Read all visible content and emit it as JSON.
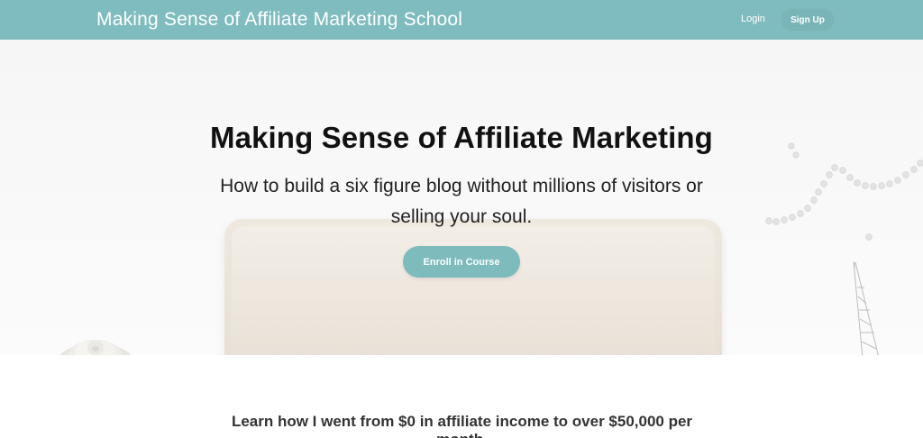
{
  "header": {
    "brand": "Making Sense of Affiliate Marketing School",
    "login_label": "Login",
    "signup_label": "Sign Up"
  },
  "hero": {
    "title": "Making Sense of Affiliate Marketing",
    "subtitle": "How to build a six figure blog without millions of visitors or selling your soul.",
    "cta_label": "Enroll in Course"
  },
  "content": {
    "intro": "Learn how I went from $0 in affiliate income to over $50,000 per month."
  },
  "colors": {
    "accent": "#7fbcbf",
    "cta": "#7dbbbd",
    "text_dark": "#111111"
  },
  "icons": {
    "decor_left": "flower-decoration",
    "decor_right_pearls": "pearls-decoration",
    "decor_right_tower": "eiffel-tower-decoration",
    "hero_device": "laptop-decoration"
  }
}
